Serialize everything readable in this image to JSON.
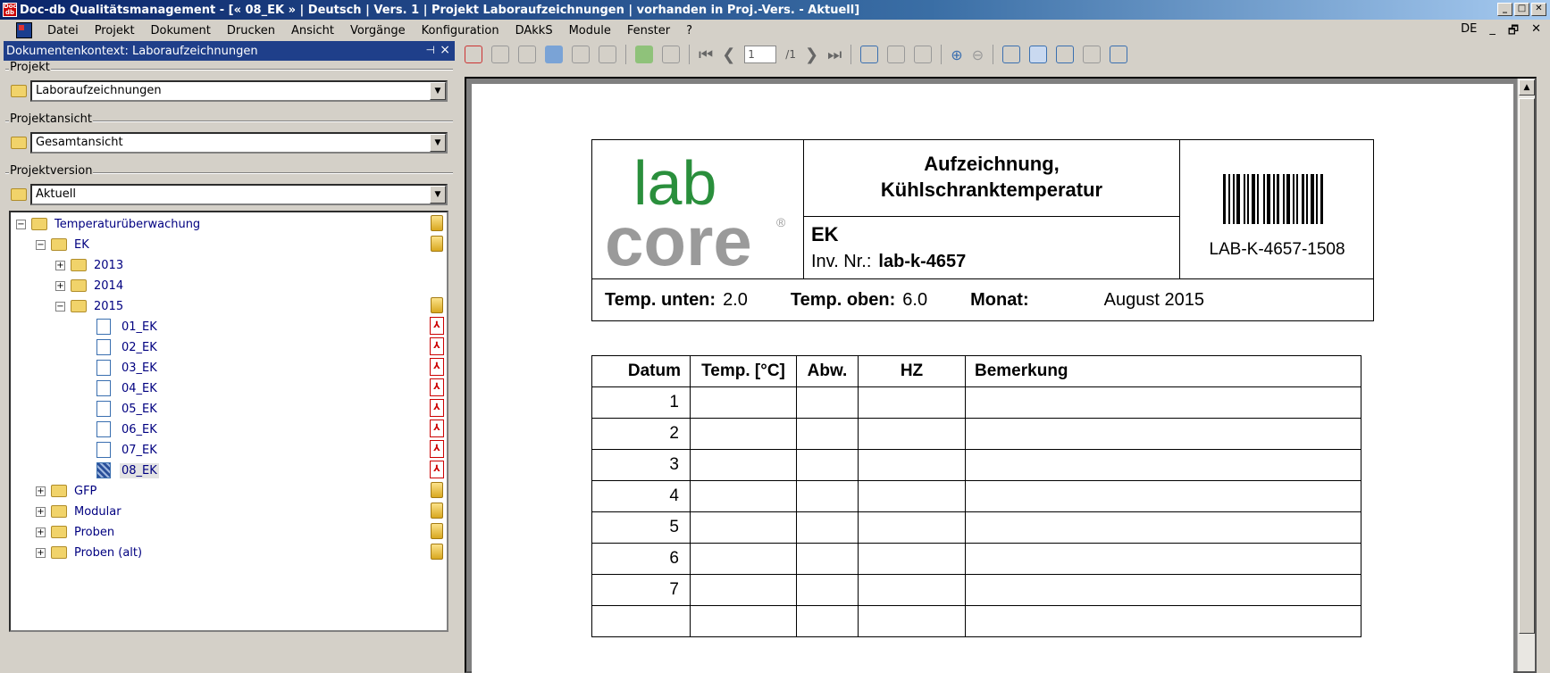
{
  "window": {
    "title": "Doc-db Qualitätsmanagement - [« 08_EK » | Deutsch | Vers. 1 | Projekt Laboraufzeichnungen | vorhanden in Proj.-Vers. - Aktuell]",
    "icon_label": "Doc db"
  },
  "menu": {
    "items": [
      "Datei",
      "Projekt",
      "Dokument",
      "Drucken",
      "Ansicht",
      "Vorgänge",
      "Konfiguration",
      "DAkkS",
      "Module",
      "Fenster",
      "?"
    ],
    "language": "DE"
  },
  "panel": {
    "title": "Dokumentenkontext: Laboraufzeichnungen",
    "project": {
      "label": "Projekt",
      "value": "Laboraufzeichnungen"
    },
    "view": {
      "label": "Projektansicht",
      "value": "Gesamtansicht"
    },
    "version": {
      "label": "Projektversion",
      "value": "Aktuell"
    }
  },
  "tree": {
    "root": "Temperaturüberwachung",
    "ek": "EK",
    "years": [
      "2013",
      "2014",
      "2015"
    ],
    "docs": [
      "01_EK",
      "02_EK",
      "03_EK",
      "04_EK",
      "05_EK",
      "06_EK",
      "07_EK",
      "08_EK"
    ],
    "selected": "08_EK",
    "others": [
      "GFP",
      "Modular",
      "Proben",
      "Proben (alt)"
    ]
  },
  "viewer": {
    "page_current": "1",
    "page_total": "/1"
  },
  "document": {
    "logo_top": "lab",
    "logo_bottom": "core",
    "logo_reg": "®",
    "title_line1": "Aufzeichnung,",
    "title_line2": "Kühlschranktemperatur",
    "device": "EK",
    "inv_label": "Inv. Nr.:",
    "inv_value": "lab-k-4657",
    "barcode_text": "LAB-K-4657-1508",
    "temp_low_label": "Temp. unten:",
    "temp_low_value": "2.0",
    "temp_high_label": "Temp. oben:",
    "temp_high_value": "6.0",
    "month_label": "Monat:",
    "month_value": "August 2015",
    "table_headers": [
      "Datum",
      "Temp. [°C]",
      "Abw.",
      "HZ",
      "Bemerkung"
    ],
    "rows": [
      "1",
      "2",
      "3",
      "4",
      "5",
      "6",
      "7",
      ""
    ]
  }
}
